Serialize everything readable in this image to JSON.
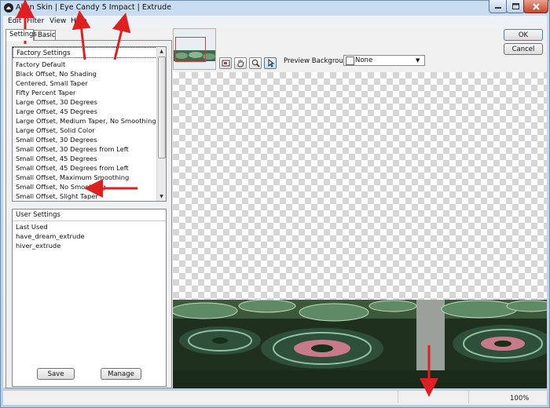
{
  "window": {
    "title": "Alien Skin | Eye Candy 5 Impact | Extrude"
  },
  "menu": [
    "Edit",
    "Filter",
    "View",
    "Help"
  ],
  "tabs": [
    {
      "label": "Settings",
      "active": true
    },
    {
      "label": "Basic",
      "active": false
    }
  ],
  "factory_settings": {
    "header": "Factory Settings",
    "items": [
      "Factory Default",
      "Black Offset, No Shading",
      "Centered, Small Taper",
      "Fifty Percent Taper",
      "Large Offset, 30 Degrees",
      "Large Offset, 45 Degrees",
      "Large Offset, Medium Taper, No Smoothing",
      "Large Offset, Solid Color",
      "Small Offset, 30 Degrees",
      "Small Offset, 30 Degrees from Left",
      "Small Offset, 45 Degrees",
      "Small Offset, 45 Degrees from Left",
      "Small Offset, Maximum Smoothing",
      "Small Offset, No Smoothing",
      "Small Offset, Slight Taper"
    ]
  },
  "user_settings": {
    "header": "User Settings",
    "items": [
      "Last Used",
      "have_dream_extrude",
      "hiver_extrude"
    ]
  },
  "buttons": {
    "save": "Save",
    "manage": "Manage",
    "ok": "OK",
    "cancel": "Cancel"
  },
  "preview": {
    "background_label": "Preview Background:",
    "background_value": "None"
  },
  "status": {
    "zoom": "100%"
  },
  "colors": {
    "annotation_arrow": "#e02020",
    "title_bar": "#c9dcf0",
    "preview_foliage": "#3d6b4f"
  },
  "icons": [
    "app-logo-icon",
    "minimize-icon",
    "maximize-icon",
    "close-icon",
    "navigator-icon",
    "hand-icon",
    "zoom-icon",
    "pointer-icon",
    "dropdown-arrow-icon"
  ]
}
